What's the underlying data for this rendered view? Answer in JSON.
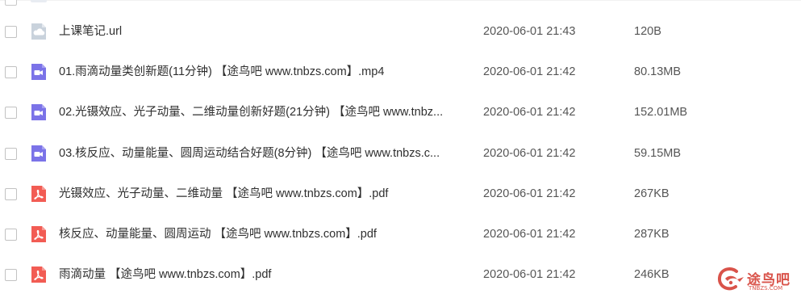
{
  "colors": {
    "cloud_icon": "#c9d2dc",
    "video_icon": "#7b73e8",
    "pdf_icon": "#f25c54",
    "watermark": "#d9534a"
  },
  "files": [
    {
      "icon": "cloud-link-icon",
      "name": "上课笔记.url",
      "date": "2020-06-01 21:43",
      "size": "120B"
    },
    {
      "icon": "video-icon",
      "name": "01.雨滴动量类创新题(11分钟) 【途鸟吧 www.tnbzs.com】.mp4",
      "date": "2020-06-01 21:42",
      "size": "80.13MB"
    },
    {
      "icon": "video-icon",
      "name": "02.光镊效应、光子动量、二维动量创新好题(21分钟) 【途鸟吧 www.tnbz...",
      "date": "2020-06-01 21:42",
      "size": "152.01MB"
    },
    {
      "icon": "video-icon",
      "name": "03.核反应、动量能量、圆周运动结合好题(8分钟) 【途鸟吧 www.tnbzs.c...",
      "date": "2020-06-01 21:42",
      "size": "59.15MB"
    },
    {
      "icon": "pdf-icon",
      "name": "光镊效应、光子动量、二维动量 【途鸟吧 www.tnbzs.com】.pdf",
      "date": "2020-06-01 21:42",
      "size": "267KB"
    },
    {
      "icon": "pdf-icon",
      "name": "核反应、动量能量、圆周运动 【途鸟吧 www.tnbzs.com】.pdf",
      "date": "2020-06-01 21:42",
      "size": "287KB"
    },
    {
      "icon": "pdf-icon",
      "name": "雨滴动量 【途鸟吧 www.tnbzs.com】.pdf",
      "date": "2020-06-01 21:42",
      "size": "246KB"
    }
  ],
  "watermark": {
    "title": "途鸟吧",
    "subtitle": "TNBZS.COM"
  }
}
